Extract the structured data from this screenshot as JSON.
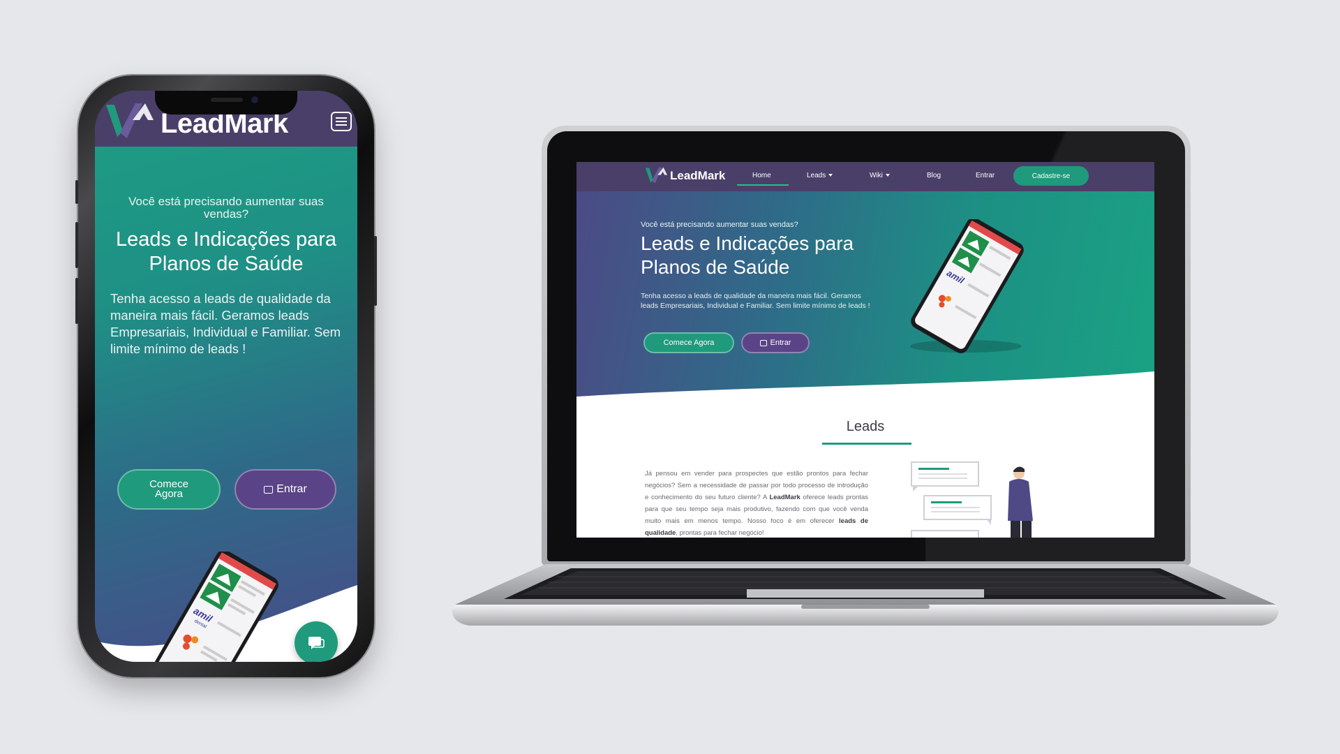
{
  "brand": {
    "name": "LeadMark"
  },
  "colors": {
    "primary_green": "#1f9a7c",
    "nav_purple": "#4a3f68",
    "button_purple": "#5a4487",
    "background": "#e6e7ea"
  },
  "nav": {
    "items": [
      "Home",
      "Leads",
      "Wiki",
      "Blog",
      "Entrar"
    ],
    "signup": "Cadastre-se"
  },
  "hero": {
    "question": "Você está precisando aumentar suas vendas?",
    "title": "Leads e Indicações para Planos de Saúde",
    "description": "Tenha acesso a leads de qualidade da maneira mais fácil. Geramos leads Empresariais, Individual e Familiar. Sem limite mínimo de leads !",
    "cta_primary": "Comece Agora",
    "cta_secondary": "Entrar"
  },
  "leads_section": {
    "title": "Leads",
    "text_1": "Já pensou em vender para prospectes que estão prontos para fechar negócios? Sem a necessidade de passar por todo processo de introdução e conhecimento do seu futuro cliente? A ",
    "text_brand": "LeadMark",
    "text_2": " oferece leads prontas para que seu tempo seja mais produtivo, fazendo com que você venda muito mais em menos tempo. Nosso foco é em oferecer ",
    "text_bold": "leads de qualidade",
    "text_3": ", prontas para fechar negócio!"
  },
  "app_mockup": {
    "brands": [
      "amil",
      "dental"
    ],
    "prices": [
      "R$ 14,90",
      "R$ 7,90",
      "R$ 14,90"
    ]
  },
  "icons": [
    "hamburger-menu-icon",
    "sign-in-icon",
    "chat-icon",
    "caret-down-icon",
    "leadmark-logo-icon"
  ]
}
